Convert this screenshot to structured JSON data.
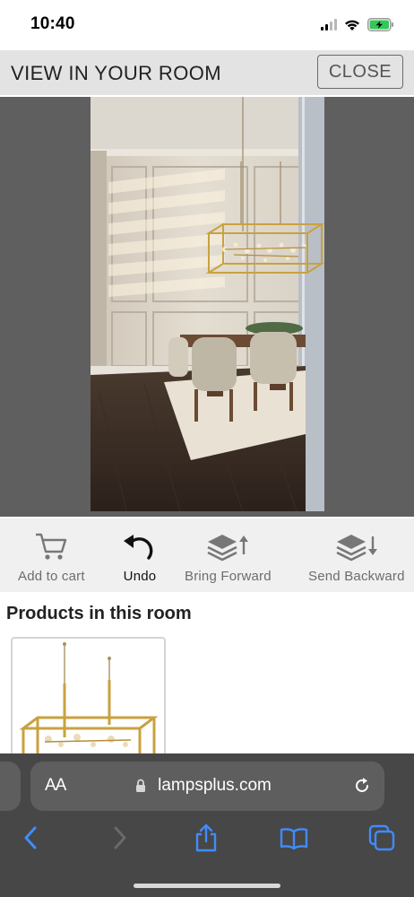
{
  "status_bar": {
    "time": "10:40",
    "icons": [
      "cellular-signal-icon",
      "wifi-icon",
      "battery-charging-icon"
    ],
    "battery_color": "#34c759"
  },
  "header": {
    "title": "VIEW IN YOUR ROOM",
    "close_label": "CLOSE"
  },
  "viewer": {
    "background_color": "#5f5f5f",
    "photo": "room-with-chandelier-preview"
  },
  "toolbar": {
    "items": [
      {
        "label": "Add to cart",
        "icon": "cart-icon"
      },
      {
        "label": "Undo",
        "icon": "undo-icon"
      },
      {
        "label": "Bring Forward",
        "icon": "bring-forward-icon"
      },
      {
        "label": "Send Backward",
        "icon": "send-backward-icon"
      }
    ]
  },
  "products": {
    "title": "Products in this room",
    "items": [
      {
        "image": "gold-linear-chandelier-thumbnail"
      }
    ]
  },
  "browser": {
    "text_size_label": "AA",
    "host": "lampsplus.com",
    "accent_color": "#3f8cff",
    "nav": [
      "back-icon",
      "forward-icon",
      "share-icon",
      "bookmarks-icon",
      "tabs-icon"
    ]
  }
}
